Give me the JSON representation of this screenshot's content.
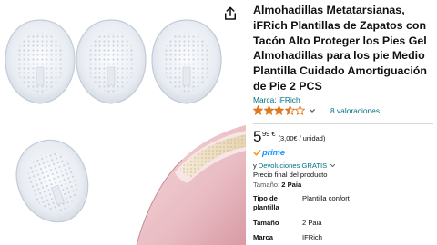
{
  "product": {
    "title": "Almohadillas Metatarsianas, iFRich Plantillas de Zapatos con Tacón Alto Proteger los Pies Gel Almohadillas para los pie Medio Plantilla Cuidado Amortiguación de Pie 2 PCS",
    "brand_link": "Marca: iFRich",
    "rating_value": 3.5,
    "ratings_count": "8 valoraciones"
  },
  "price": {
    "currency": "€",
    "whole": "5",
    "fraction": "99",
    "unit_price": "(3,00€ / unidad)"
  },
  "prime": {
    "label": "prime"
  },
  "returns": {
    "prefix": "y",
    "link": "Devoluciones GRATIS"
  },
  "final_price_text": "Precio final del producto",
  "size": {
    "label": "Tamaño:",
    "value": "2 Paia"
  },
  "specs": [
    {
      "key": "Tipo de plantilla",
      "value": "Plantilla confort"
    },
    {
      "key": "Tamaño",
      "value": "2 Paia"
    },
    {
      "key": "Marca",
      "value": "IFRich"
    }
  ],
  "icons": {
    "share": "share-icon",
    "star": "star-icon",
    "chevron": "chevron-down-icon",
    "prime_check": "checkmark-icon"
  },
  "colors": {
    "link": "#007185",
    "star": "#de7921",
    "prime": "#1a98ff",
    "text": "#0f1111"
  }
}
